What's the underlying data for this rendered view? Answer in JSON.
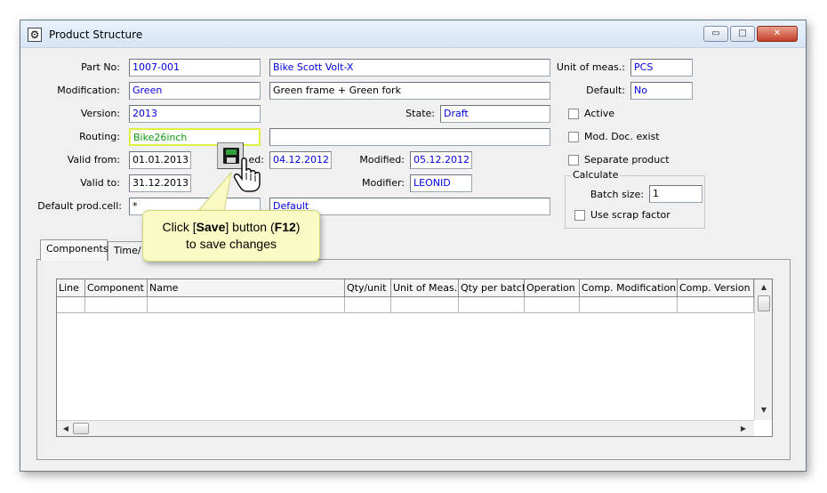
{
  "window": {
    "title": "Product Structure",
    "controls": {
      "minimize": "▭",
      "maximize": "□",
      "close": "✕"
    }
  },
  "form": {
    "part_no": {
      "label": "Part No:",
      "value": "1007-001",
      "description": "Bike Scott Volt-X"
    },
    "modification": {
      "label": "Modification:",
      "value": "Green",
      "description": "Green frame + Green fork"
    },
    "version": {
      "label": "Version:",
      "value": "2013"
    },
    "state": {
      "label": "State:",
      "value": "Draft"
    },
    "routing": {
      "label": "Routing:",
      "value": "Bike26inch",
      "description": ""
    },
    "valid_from": {
      "label": "Valid from:",
      "value": "01.01.2013"
    },
    "created": {
      "label_fragment": "ed:",
      "value": "04.12.2012"
    },
    "modified": {
      "label": "Modified:",
      "value": "05.12.2012"
    },
    "valid_to": {
      "label": "Valid to:",
      "value": "31.12.2013"
    },
    "modifier": {
      "label": "Modifier:",
      "value": "LEONID"
    },
    "default_prod_cell": {
      "label": "Default prod.cell:",
      "value": "*",
      "description": "Default"
    },
    "unit_of_meas": {
      "label": "Unit of meas.:",
      "value": "PCS"
    },
    "default": {
      "label": "Default:",
      "value": "No"
    },
    "active": {
      "label": "Active",
      "checked": false
    },
    "mod_doc_exist": {
      "label": "Mod. Doc. exist",
      "checked": false
    },
    "separate_product": {
      "label": "Separate product",
      "checked": false
    },
    "calculate": {
      "group_label": "Calculate",
      "batch_size": {
        "label": "Batch size:",
        "value": "1"
      },
      "use_scrap_factor": {
        "label": "Use scrap factor",
        "checked": false
      }
    }
  },
  "tabs": [
    {
      "label": "Components"
    },
    {
      "label": "Time/"
    }
  ],
  "grid": {
    "columns": [
      "Line",
      "Component",
      "Name",
      "Qty/unit",
      "Unit of Meas.",
      "Qty per batch",
      "Operation",
      "Comp. Modification",
      "Comp. Version"
    ],
    "rows": []
  },
  "toolbar": {
    "save_icon": "floppy-disk-icon"
  },
  "callout": {
    "line1_pre": "Click [",
    "line1_bold1": "Save",
    "line1_mid": "] button (",
    "line1_bold2": "F12",
    "line1_post": ")",
    "line2": "to save changes"
  },
  "scroll": {
    "up": "▲",
    "down": "▼",
    "left": "◀",
    "right": "▶"
  }
}
